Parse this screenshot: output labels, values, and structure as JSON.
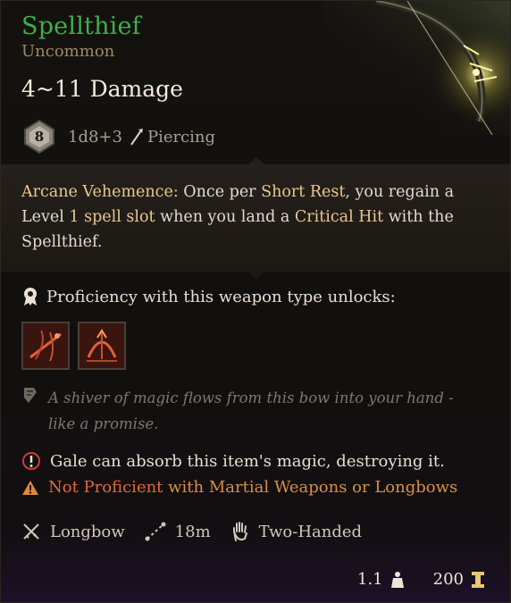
{
  "item": {
    "name": "Spellthief",
    "rarity": "Uncommon",
    "damage": "4~11 Damage",
    "die_face": "8",
    "dice": "1d8+3",
    "damage_type": "Piercing"
  },
  "passive": {
    "title": "Arcane Vehemence:",
    "t1": " Once per ",
    "k1": "Short Rest",
    "t2": ", you regain a Level ",
    "k2": "1 spell slot",
    "t3": " when you land a ",
    "k3": "Critical Hit",
    "t4": " with the Spellthief."
  },
  "proficiency": {
    "label": "Proficiency with this weapon type unlocks:",
    "actions": [
      "action-icon-1",
      "action-icon-2"
    ]
  },
  "flavor": "A shiver of magic flows from this bow into your hand - like a promise.",
  "absorb": "Gale can absorb this item's magic, destroying it.",
  "warning": {
    "not_proficient": "Not Proficient",
    "detail": " with Martial Weapons or Longbows"
  },
  "properties": {
    "type": "Longbow",
    "range": "18m",
    "handed": "Two-Handed"
  },
  "footer": {
    "weight": "1.1",
    "value": "200"
  },
  "colors": {
    "name": "#3fae4a",
    "rarity": "#9c8a62",
    "keyword": "#e9c98b",
    "warning": "#e06a3a"
  }
}
